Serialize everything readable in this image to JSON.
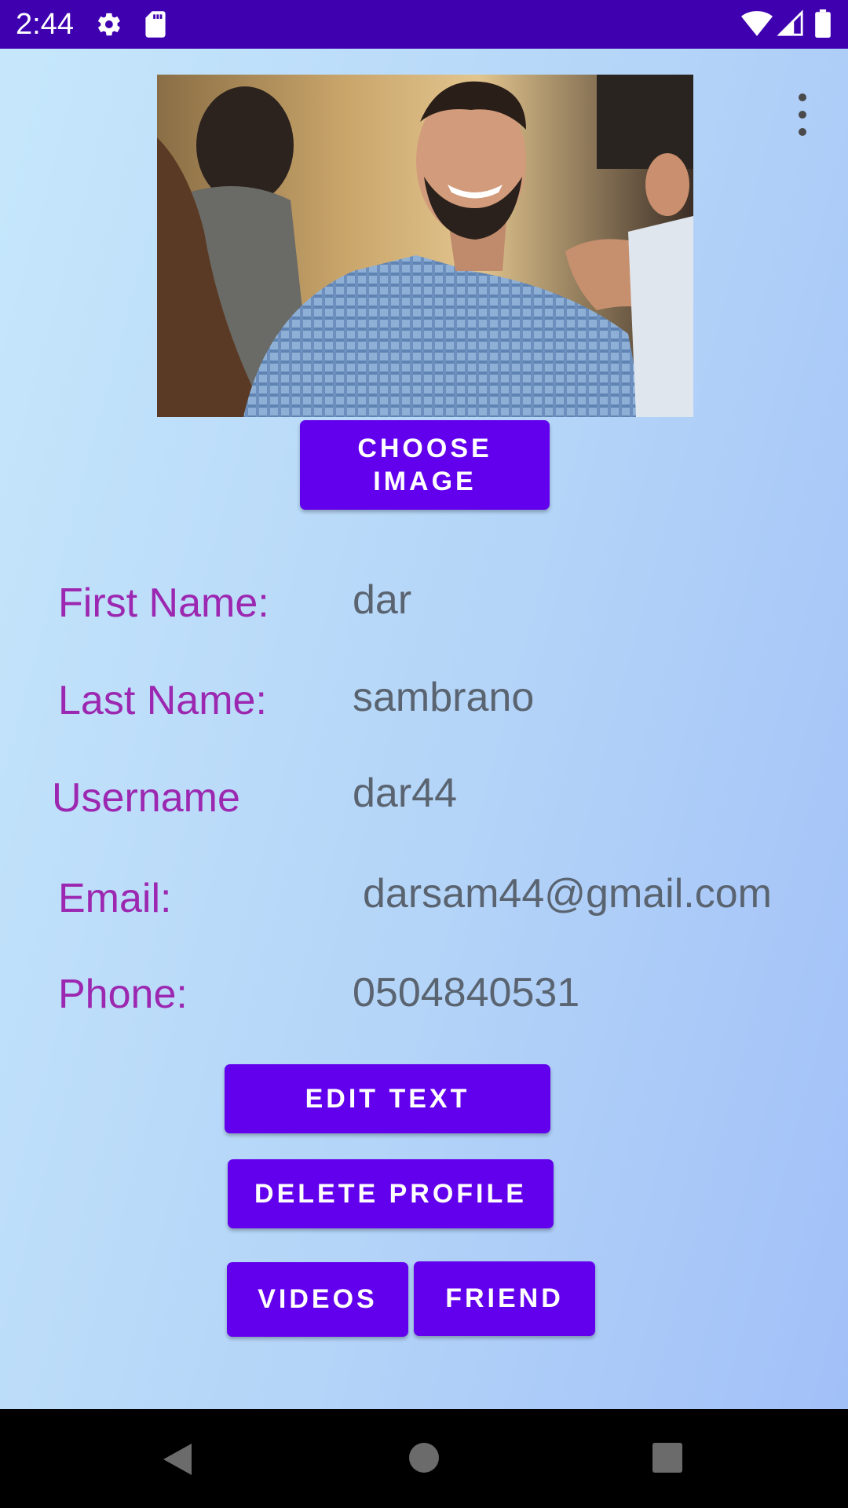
{
  "status_bar": {
    "time": "2:44",
    "icons": [
      "gear-icon",
      "sd-card-icon",
      "wifi-icon",
      "signal-icon",
      "battery-icon"
    ]
  },
  "app_bar": {
    "menu_icon": "more-vert-icon"
  },
  "profile": {
    "photo_alt": "profile-photo",
    "choose_image_label": "CHOOSE\nIMAGE",
    "fields": [
      {
        "label": "First Name:",
        "value": "dar"
      },
      {
        "label": "Last Name:",
        "value": "sambrano"
      },
      {
        "label": "Username",
        "value": "dar44"
      },
      {
        "label": "Email:",
        "value": "darsam44@gmail.com"
      },
      {
        "label": "Phone:",
        "value": "0504840531"
      }
    ]
  },
  "actions": {
    "edit_text": "EDIT TEXT",
    "delete_profile": "DELETE PROFILE",
    "videos": "VIDEOS",
    "friend": "FRIEND"
  },
  "nav_bar": {
    "icons": [
      "back-icon",
      "home-icon",
      "recents-icon"
    ]
  },
  "colors": {
    "status_bar": "#3f00b0",
    "button": "#6200ee",
    "label": "#9c27b0",
    "value": "#5a6470"
  }
}
